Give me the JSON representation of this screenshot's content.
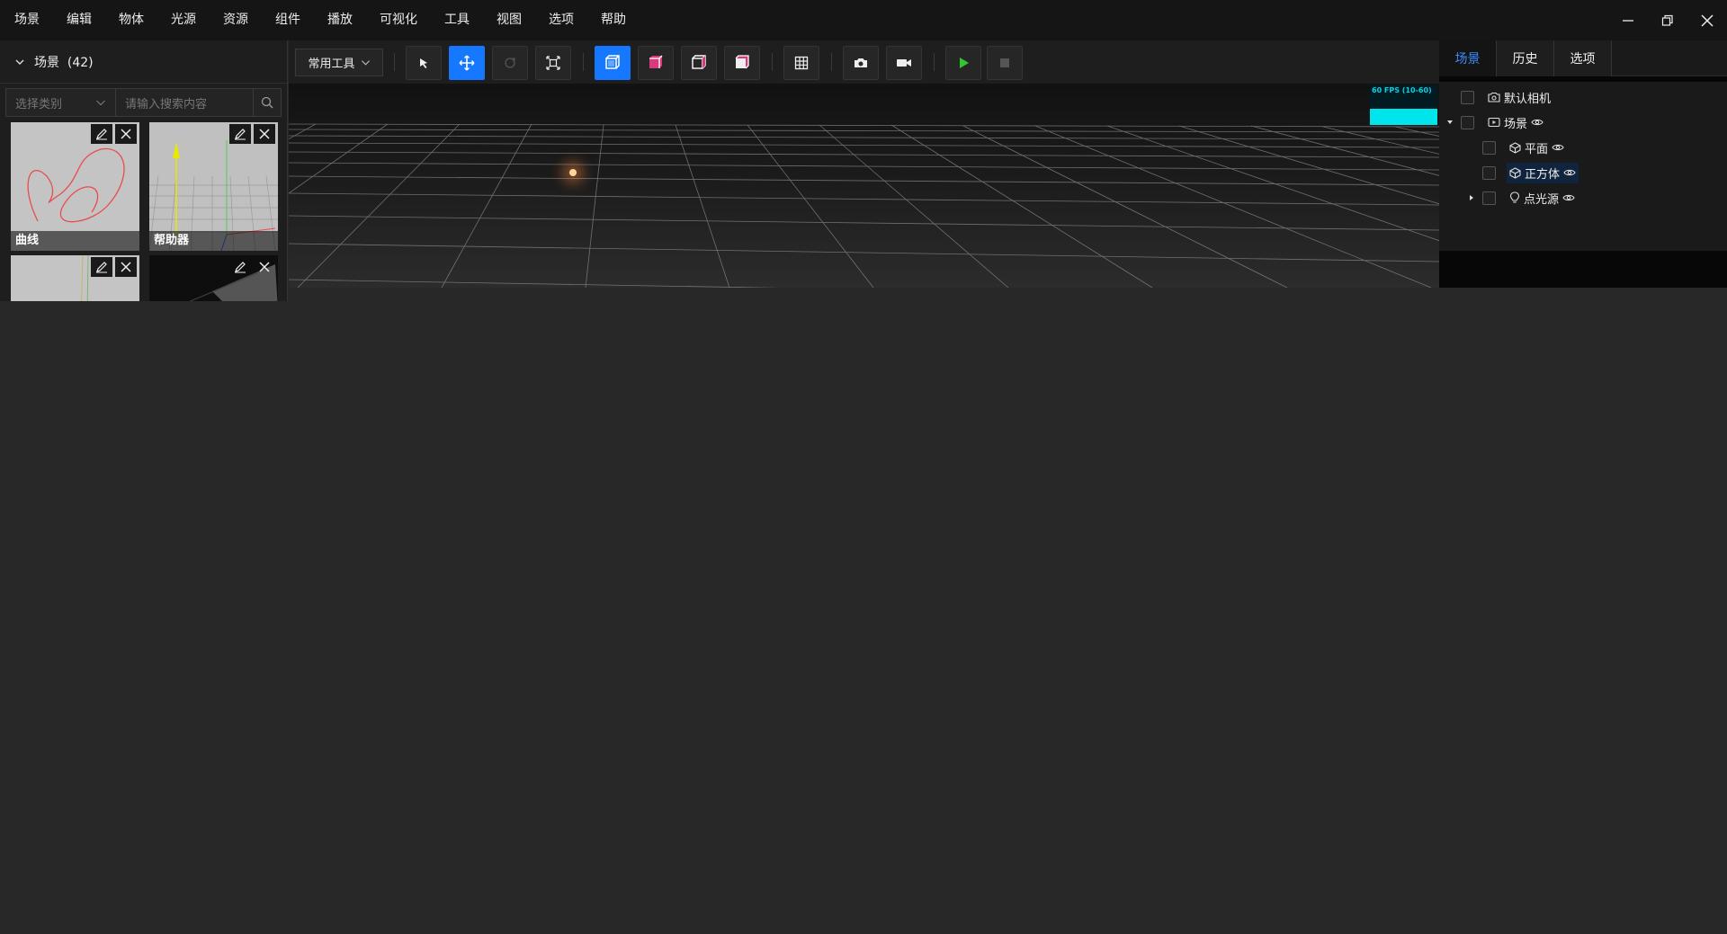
{
  "menu": [
    "场景",
    "编辑",
    "物体",
    "光源",
    "资源",
    "组件",
    "播放",
    "可视化",
    "工具",
    "视图",
    "选项",
    "帮助"
  ],
  "left_panel": {
    "title": "场景  (42)",
    "filter_placeholder": "选择类别",
    "search_placeholder": "请输入搜索内容",
    "cards": [
      {
        "label": "曲线"
      },
      {
        "label": "帮助器"
      },
      {
        "label": ""
      },
      {
        "label": ""
      }
    ]
  },
  "toolbar": {
    "dropdown_label": "常用工具",
    "accent": "#1677ff"
  },
  "viewport": {
    "fps_text": "60 FPS (10-60)",
    "fps_color": "#00e5ec"
  },
  "right_panel": {
    "tabs": [
      "场景",
      "历史",
      "选项"
    ],
    "active_tab": "场景",
    "tree": [
      {
        "label": "默认相机",
        "icon": "camera-icon"
      },
      {
        "label": "场景",
        "icon": "scene-icon"
      },
      {
        "label": "平面",
        "icon": "mesh-icon"
      },
      {
        "label": "正方体",
        "icon": "mesh-icon"
      },
      {
        "label": "点光源",
        "icon": "bulb-icon"
      }
    ]
  }
}
